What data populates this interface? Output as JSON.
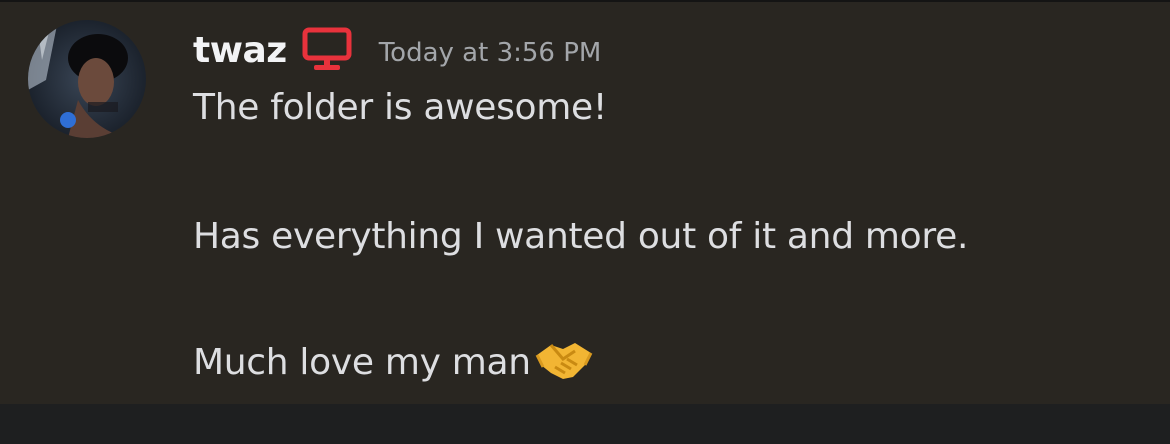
{
  "message": {
    "author": {
      "username": "twaz",
      "badge_icon": "monitor-icon",
      "badge_color": "#e8323c"
    },
    "timestamp": "Today at 3:56 PM",
    "lines": [
      "The folder is awesome!",
      "Has everything I wanted out of it and more.",
      "Much love my man"
    ],
    "emoji": "handshake-emoji"
  },
  "colors": {
    "message_bg": "#292621",
    "username": "#f2f3f5",
    "text": "#dddee1",
    "timestamp": "#a3a6aa"
  }
}
